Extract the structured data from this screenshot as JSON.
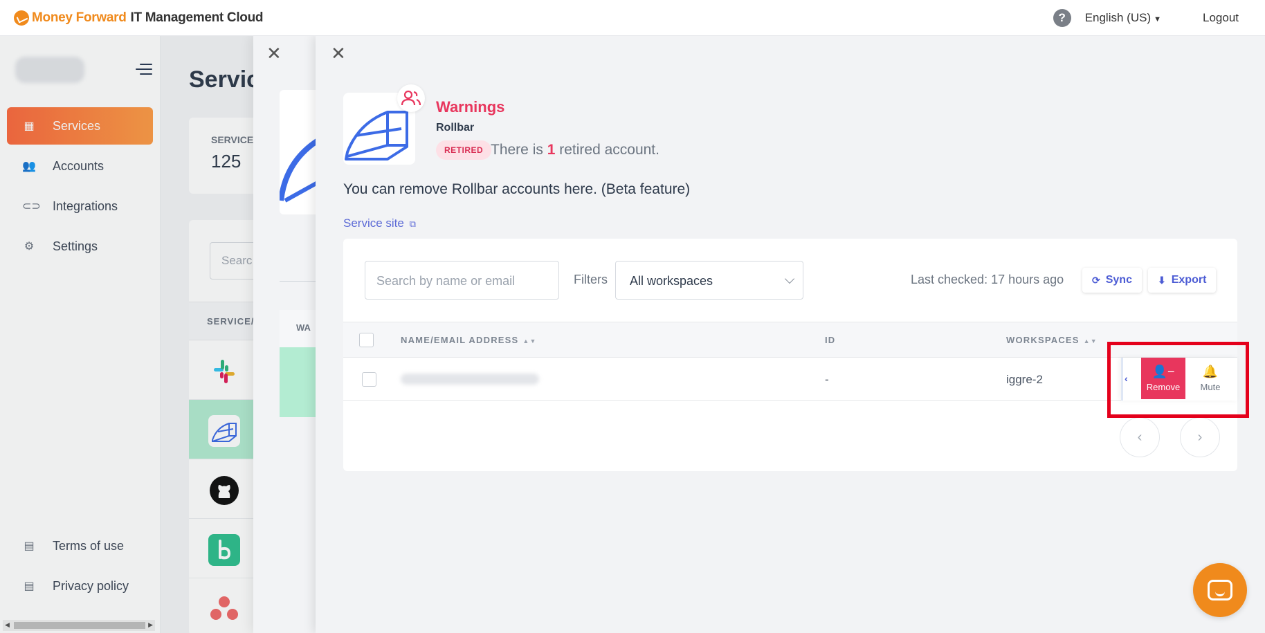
{
  "topbar": {
    "brand_part1": "Money Forward",
    "brand_part2": "IT Management Cloud",
    "language": "English (US)",
    "logout": "Logout"
  },
  "sidebar": {
    "items": [
      {
        "label": "Services",
        "icon": "grid-icon",
        "active": true
      },
      {
        "label": "Accounts",
        "icon": "users-icon"
      },
      {
        "label": "Integrations",
        "icon": "link-icon"
      },
      {
        "label": "Settings",
        "icon": "gear-icon"
      }
    ],
    "footer": [
      {
        "label": "Terms of use",
        "icon": "document-icon"
      },
      {
        "label": "Privacy policy",
        "icon": "document-icon"
      }
    ]
  },
  "background_page": {
    "title": "Servic",
    "stat_label": "SERVICE",
    "stat_value": "125",
    "search_placeholder": "Searc",
    "column_header": "SERVICE/",
    "drawer_column_header": "WA"
  },
  "drawer": {
    "status_title": "Warnings",
    "service_name": "Rollbar",
    "retired_badge": "RETIRED",
    "retired_prefix": "There is",
    "retired_count": "1",
    "retired_suffix": "retired account.",
    "description": "You can remove Rollbar accounts here. (Beta feature)",
    "service_site": "Service site",
    "search_placeholder": "Search by name or email",
    "filters_label": "Filters",
    "workspace_filter": "All workspaces",
    "last_checked": "Last checked: 17 hours ago",
    "sync_label": "Sync",
    "export_label": "Export",
    "columns": {
      "name": "NAME/EMAIL ADDRESS",
      "id": "ID",
      "workspaces": "WORKSPACES"
    },
    "rows": [
      {
        "id": "-",
        "workspace": "iggre-2"
      }
    ],
    "actions": {
      "remove": "Remove",
      "mute": "Mute"
    }
  },
  "colors": {
    "accent_orange": "#f08a1c",
    "warning_red": "#e8365d",
    "link_blue": "#4b5bd4",
    "highlight": "#e4001b"
  }
}
